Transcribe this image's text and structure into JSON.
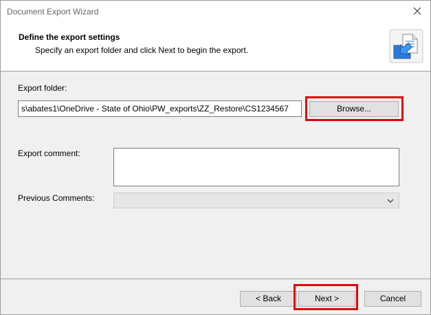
{
  "window": {
    "title": "Document Export Wizard",
    "close_icon": "close-icon"
  },
  "header": {
    "title": "Define the export settings",
    "subtitle": "Specify an export folder and click Next to begin the export.",
    "icon": "export-wizard-icon"
  },
  "export_folder": {
    "label": "Export folder:",
    "value": "s\\abates1\\OneDrive - State of Ohio\\PW_exports\\ZZ_Restore\\CS1234567",
    "browse_label": "Browse..."
  },
  "export_comment": {
    "label": "Export comment:",
    "value": ""
  },
  "previous_comments": {
    "label": "Previous Comments:",
    "selected": ""
  },
  "buttons": {
    "back": "< Back",
    "next": "Next >",
    "cancel": "Cancel"
  },
  "highlight_color": "#e0000a"
}
